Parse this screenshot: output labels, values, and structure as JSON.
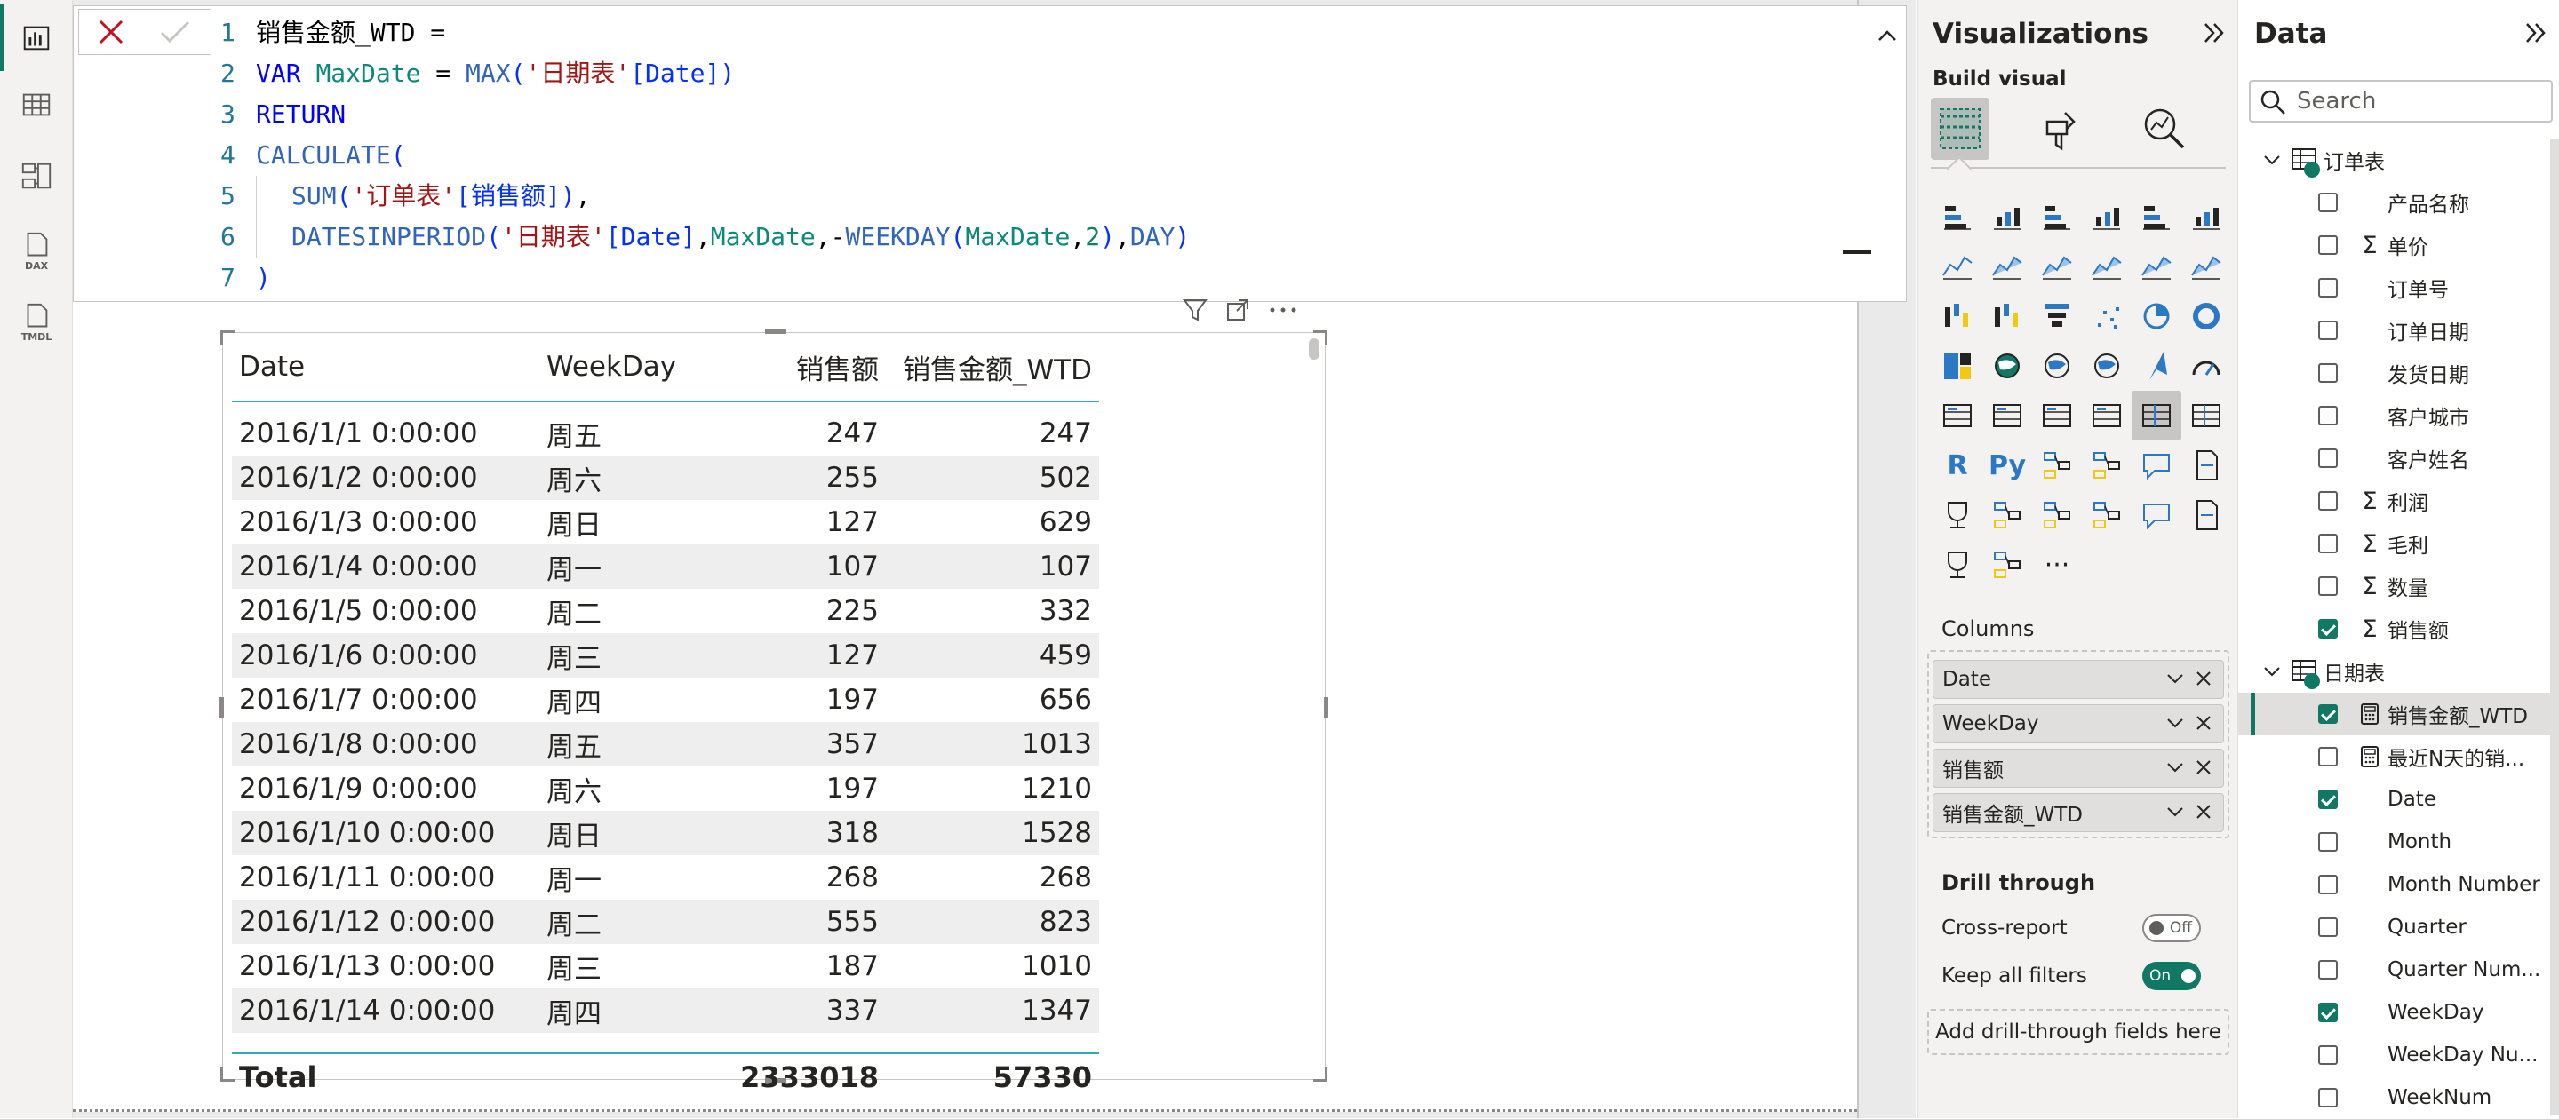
{
  "nav": {
    "items": [
      {
        "name": "report-view",
        "active": true
      },
      {
        "name": "table-view",
        "active": false
      },
      {
        "name": "model-view",
        "active": false
      },
      {
        "name": "dax-query-view",
        "label": "DAX",
        "active": false
      },
      {
        "name": "tmdl-view",
        "label": "TMDL",
        "active": false
      }
    ]
  },
  "formula": {
    "lines": [
      {
        "n": "1",
        "tokens": [
          {
            "t": "销售金额_WTD = ",
            "c": "plain"
          }
        ]
      },
      {
        "n": "2",
        "tokens": [
          {
            "t": "VAR ",
            "c": "kw"
          },
          {
            "t": "MaxDate",
            "c": "var"
          },
          {
            "t": " = ",
            "c": "plain"
          },
          {
            "t": "MAX",
            "c": "fn"
          },
          {
            "t": "(",
            "c": "bracket"
          },
          {
            "t": "'日期表'",
            "c": "str"
          },
          {
            "t": "[Date]",
            "c": "bracket"
          },
          {
            "t": ")",
            "c": "bracket"
          }
        ]
      },
      {
        "n": "3",
        "tokens": [
          {
            "t": "RETURN",
            "c": "kw"
          }
        ]
      },
      {
        "n": "4",
        "tokens": [
          {
            "t": "CALCULATE",
            "c": "fn"
          },
          {
            "t": "(",
            "c": "bracket"
          }
        ]
      },
      {
        "n": "5",
        "indent": true,
        "tokens": [
          {
            "t": "SUM",
            "c": "fn"
          },
          {
            "t": "(",
            "c": "bracket"
          },
          {
            "t": "'订单表'",
            "c": "str"
          },
          {
            "t": "[销售额]",
            "c": "bracket"
          },
          {
            "t": ")",
            "c": "bracket"
          },
          {
            "t": ",",
            "c": "plain"
          }
        ]
      },
      {
        "n": "6",
        "indent": true,
        "tokens": [
          {
            "t": "DATESINPERIOD",
            "c": "fn"
          },
          {
            "t": "(",
            "c": "bracket"
          },
          {
            "t": "'日期表'",
            "c": "str"
          },
          {
            "t": "[Date]",
            "c": "bracket"
          },
          {
            "t": ",",
            "c": "plain"
          },
          {
            "t": "MaxDate",
            "c": "var"
          },
          {
            "t": ",-",
            "c": "plain"
          },
          {
            "t": "WEEKDAY",
            "c": "fn"
          },
          {
            "t": "(",
            "c": "bracket"
          },
          {
            "t": "MaxDate",
            "c": "var"
          },
          {
            "t": ",",
            "c": "plain"
          },
          {
            "t": "2",
            "c": "num"
          },
          {
            "t": ")",
            "c": "bracket"
          },
          {
            "t": ",",
            "c": "plain"
          },
          {
            "t": "DAY",
            "c": "fn"
          },
          {
            "t": ")",
            "c": "bracket"
          }
        ]
      },
      {
        "n": "7",
        "tokens": [
          {
            "t": ")",
            "c": "bracket"
          }
        ]
      }
    ]
  },
  "table": {
    "columns": [
      "Date",
      "WeekDay",
      "销售额",
      "销售金额_WTD"
    ],
    "rows": [
      [
        "2016/1/1 0:00:00",
        "周五",
        "247",
        "247"
      ],
      [
        "2016/1/2 0:00:00",
        "周六",
        "255",
        "502"
      ],
      [
        "2016/1/3 0:00:00",
        "周日",
        "127",
        "629"
      ],
      [
        "2016/1/4 0:00:00",
        "周一",
        "107",
        "107"
      ],
      [
        "2016/1/5 0:00:00",
        "周二",
        "225",
        "332"
      ],
      [
        "2016/1/6 0:00:00",
        "周三",
        "127",
        "459"
      ],
      [
        "2016/1/7 0:00:00",
        "周四",
        "197",
        "656"
      ],
      [
        "2016/1/8 0:00:00",
        "周五",
        "357",
        "1013"
      ],
      [
        "2016/1/9 0:00:00",
        "周六",
        "197",
        "1210"
      ],
      [
        "2016/1/10 0:00:00",
        "周日",
        "318",
        "1528"
      ],
      [
        "2016/1/11 0:00:00",
        "周一",
        "268",
        "268"
      ],
      [
        "2016/1/12 0:00:00",
        "周二",
        "555",
        "823"
      ],
      [
        "2016/1/13 0:00:00",
        "周三",
        "187",
        "1010"
      ],
      [
        "2016/1/14 0:00:00",
        "周四",
        "337",
        "1347"
      ]
    ],
    "total": {
      "label": "Total",
      "weekday": "",
      "sales": "2333018",
      "wtd": "57330"
    }
  },
  "visualizations": {
    "title": "Visualizations",
    "build_visual": "Build visual",
    "columns_label": "Columns",
    "wells": [
      "Date",
      "WeekDay",
      "销售额",
      "销售金额_WTD"
    ],
    "drill_through": {
      "title": "Drill through",
      "cross_report": "Cross-report",
      "cross_report_state": "Off",
      "keep_all_filters": "Keep all filters",
      "keep_all_filters_state": "On",
      "add_fields": "Add drill-through fields here"
    },
    "visual_icons": [
      "stacked-bar-icon",
      "stacked-column-icon",
      "clustered-bar-icon",
      "clustered-column-icon",
      "100-stacked-bar-icon",
      "100-stacked-column-icon",
      "line-chart-icon",
      "area-chart-icon",
      "stacked-area-icon",
      "100-stacked-area-icon",
      "line-and-column-icon",
      "line-and-clustered-column-icon",
      "ribbon-chart-icon",
      "waterfall-icon",
      "funnel-icon",
      "scatter-icon",
      "pie-chart-icon",
      "donut-chart-icon",
      "treemap-icon",
      "map-icon",
      "filled-map-icon",
      "shape-map-icon",
      "azure-map-icon",
      "gauge-icon",
      "card-icon",
      "multi-row-card-icon",
      "kpi-icon",
      "slicer-icon",
      "table-icon",
      "matrix-icon",
      "r-visual-icon",
      "python-visual-icon",
      "key-influencers-icon",
      "decomposition-tree-icon",
      "qa-icon",
      "narrative-icon",
      "paginated-report-icon",
      "metrics-icon",
      "new-card-icon",
      "new-slicer-icon",
      "button-slicer-icon",
      "list-slicer-icon",
      "power-apps-icon",
      "power-automate-icon",
      "more-visuals-icon"
    ]
  },
  "data_pane": {
    "title": "Data",
    "search_placeholder": "Search",
    "tables": [
      {
        "name": "订单表",
        "fields": [
          {
            "name": "产品名称",
            "icon": "",
            "checked": false
          },
          {
            "name": "单价",
            "icon": "sigma",
            "checked": false
          },
          {
            "name": "订单号",
            "icon": "",
            "checked": false
          },
          {
            "name": "订单日期",
            "icon": "",
            "checked": false
          },
          {
            "name": "发货日期",
            "icon": "",
            "checked": false
          },
          {
            "name": "客户城市",
            "icon": "",
            "checked": false
          },
          {
            "name": "客户姓名",
            "icon": "",
            "checked": false
          },
          {
            "name": "利润",
            "icon": "sigma",
            "checked": false
          },
          {
            "name": "毛利",
            "icon": "sigma",
            "checked": false
          },
          {
            "name": "数量",
            "icon": "sigma",
            "checked": false
          },
          {
            "name": "销售额",
            "icon": "sigma",
            "checked": true
          }
        ]
      },
      {
        "name": "日期表",
        "fields": [
          {
            "name": "销售金额_WTD",
            "icon": "calc",
            "checked": true,
            "selected": true
          },
          {
            "name": "最近N天的销...",
            "icon": "calc",
            "checked": false
          },
          {
            "name": "Date",
            "icon": "",
            "checked": true
          },
          {
            "name": "Month",
            "icon": "",
            "checked": false
          },
          {
            "name": "Month Number",
            "icon": "",
            "checked": false
          },
          {
            "name": "Quarter",
            "icon": "",
            "checked": false
          },
          {
            "name": "Quarter Num...",
            "icon": "",
            "checked": false
          },
          {
            "name": "WeekDay",
            "icon": "",
            "checked": true
          },
          {
            "name": "WeekDay Nu...",
            "icon": "",
            "checked": false
          },
          {
            "name": "WeekNum",
            "icon": "",
            "checked": false
          }
        ]
      }
    ]
  },
  "colors": {
    "accent": "#117865",
    "table_rule": "#31aab2",
    "alt_row": "#eeeeee"
  }
}
